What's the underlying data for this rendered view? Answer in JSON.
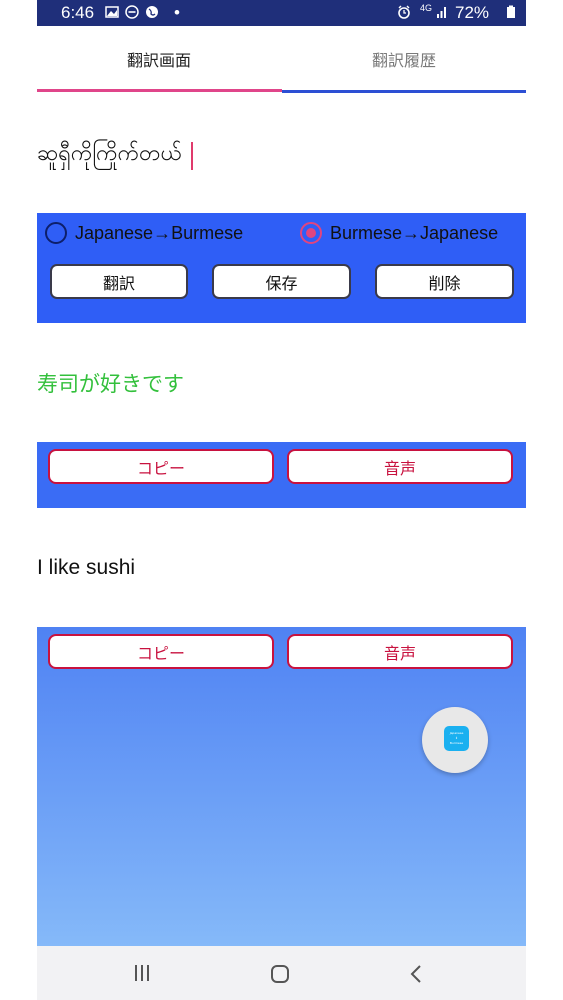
{
  "status_bar": {
    "time": "6:46",
    "dot": "•",
    "network": "4G",
    "battery": "72%",
    "icons": [
      "image-icon",
      "dnd-icon",
      "globe-icon",
      "alarm-icon",
      "network-icon",
      "signal-icon",
      "battery-icon"
    ]
  },
  "tabs": [
    {
      "label": "翻訳画面",
      "active": true
    },
    {
      "label": "翻訳履歴",
      "active": false
    }
  ],
  "input": {
    "value": "ဆူရှီကိုကြိုက်တယ်"
  },
  "direction": {
    "options": [
      {
        "label": "Japanese→Burmese",
        "selected": false
      },
      {
        "label": "Burmese→Japanese",
        "selected": true
      }
    ]
  },
  "actions": {
    "translate": "翻訳",
    "save": "保存",
    "delete": "削除"
  },
  "result_jp": {
    "text": "寿司が好きです",
    "copy": "コピー",
    "speak": "音声"
  },
  "result_en": {
    "text": "I like sushi",
    "copy": "コピー",
    "speak": "音声"
  },
  "fab": {
    "icon": "app-icon",
    "lines": [
      "Japanese",
      "↕",
      "Burmese"
    ]
  },
  "nav": {
    "icons": [
      "recents-icon",
      "home-icon",
      "back-icon"
    ]
  },
  "colors": {
    "accent": "#e0458a",
    "panel_blue": "#2f5ef6",
    "result_green": "#33c03c",
    "button_red": "#c8123f"
  }
}
